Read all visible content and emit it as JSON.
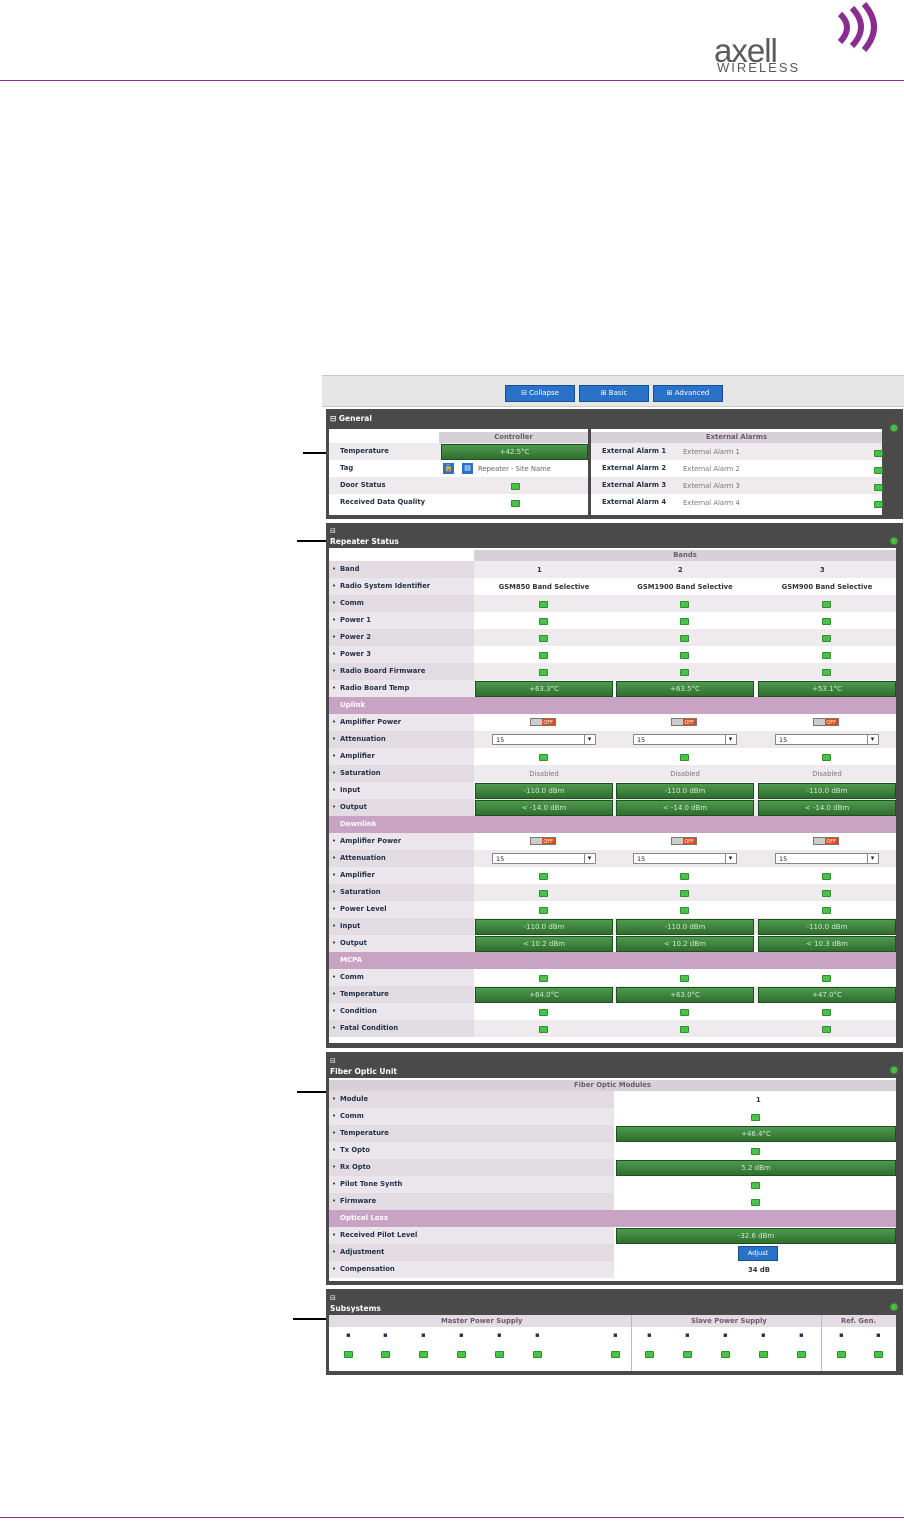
{
  "brand": {
    "name": "axell",
    "sub": "WIRELESS",
    "accent": "#8b2d8e"
  },
  "toolbar": {
    "collapse": "⊟ Collapse",
    "basic": "⊞ Basic",
    "advanced": "⊞ Advanced"
  },
  "general": {
    "title": "⊟ General",
    "controller_header": "Controller",
    "alarms_header": "External Alarms",
    "temperature_label": "Temperature",
    "temperature_value": "+42.5°C",
    "tag_label": "Tag",
    "tag_value": "Repeater - Site Name",
    "door_label": "Door Status",
    "rdq_label": "Received Data Quality",
    "alarms": [
      {
        "label": "External Alarm 1",
        "value": "External Alarm 1"
      },
      {
        "label": "External Alarm 2",
        "value": "External Alarm 2"
      },
      {
        "label": "External Alarm 3",
        "value": "External Alarm 3"
      },
      {
        "label": "External Alarm 4",
        "value": "External Alarm 4"
      }
    ]
  },
  "repeater": {
    "title": "Repeater Status",
    "bands_header": "Bands",
    "band_label": "Band",
    "bands": [
      "1",
      "2",
      "3"
    ],
    "rsi_label": "Radio System Identifier",
    "rsi": [
      "GSM850 Band Selective",
      "GSM1900 Band Selective",
      "GSM900 Band Selective"
    ],
    "comm_label": "Comm",
    "power1_label": "Power 1",
    "power2_label": "Power 2",
    "power3_label": "Power 3",
    "fw_label": "Radio Board Firmware",
    "temp_label": "Radio Board Temp",
    "temps": [
      "+63.3°C",
      "+63.5°C",
      "+53.1°C"
    ],
    "uplink_title": "Uplink",
    "amp_power_label": "Amplifier Power",
    "off_text": "OFF",
    "atten_label": "Attenuation",
    "atten_value": "15",
    "amplifier_label": "Amplifier",
    "saturation_label": "Saturation",
    "disabled_text": "Disabled",
    "input_label": "Input",
    "ul_inputs": [
      "-110.0 dBm",
      "-110.0 dBm",
      "-110.0 dBm"
    ],
    "output_label": "Output",
    "ul_outputs": [
      "< -14.0 dBm",
      "< -14.0 dBm",
      "< -14.0 dBm"
    ],
    "downlink_title": "Downlink",
    "power_level_label": "Power Level",
    "dl_inputs": [
      "-110.0 dBm",
      "-110.0 dBm",
      "-110.0 dBm"
    ],
    "dl_outputs": [
      "< 10.2 dBm",
      "< 10.2 dBm",
      "< 10.3 dBm"
    ],
    "mcpa_title": "MCPA",
    "mcpa_temp_label": "Temperature",
    "mcpa_temps": [
      "+64.0°C",
      "+63.0°C",
      "+47.0°C"
    ],
    "condition_label": "Condition",
    "fatal_label": "Fatal Condition"
  },
  "fou": {
    "title": "Fiber Optic Unit",
    "modules_header": "Fiber Optic Modules",
    "module_label": "Module",
    "module_value": "1",
    "comm_label": "Comm",
    "temp_label": "Temperature",
    "temp_value": "+46.4°C",
    "tx_label": "Tx Opto",
    "rx_label": "Rx Opto",
    "rx_value": "5.2 dBm",
    "pilot_label": "Pilot Tone Synth",
    "fw_label": "Firmware",
    "loss_title": "Optical Loss",
    "rpl_label": "Received Pilot Level",
    "rpl_value": "-32.6 dBm",
    "adj_label": "Adjustment",
    "adj_button": "Adjust",
    "comp_label": "Compensation",
    "comp_value": "34 dB"
  },
  "subsystems": {
    "title": "Subsystems",
    "master": "Master Power Supply",
    "slave": "Slave Power Supply",
    "ref": "Ref. Gen."
  }
}
